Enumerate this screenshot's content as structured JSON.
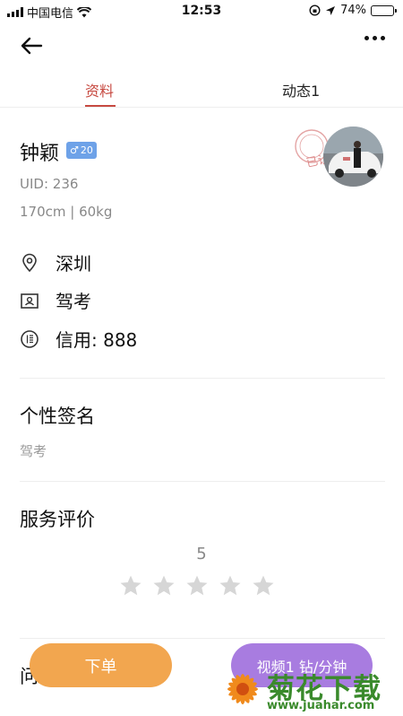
{
  "statusbar": {
    "carrier": "中国电信",
    "time": "12:53",
    "battery": "74%",
    "battery_level": 0.74
  },
  "tabs": [
    {
      "label": "资料",
      "active": true
    },
    {
      "label": "动态1",
      "active": false
    }
  ],
  "profile": {
    "name": "钟颖",
    "gender_symbol": "♂",
    "age": "20",
    "uid": "UID: 236",
    "height_weight": "170cm | 60kg",
    "stamp_text": "已认"
  },
  "info": {
    "city": "深圳",
    "service": "驾考",
    "credit": "信用: 888"
  },
  "signature": {
    "title": "个性签名",
    "text": "驾考"
  },
  "review": {
    "title": "服务评价",
    "score": "5",
    "stars_filled": 0,
    "stars_total": 5
  },
  "partial_section_title": "问",
  "actions": {
    "order": "下单",
    "video": "视频1 钻/分钟"
  },
  "watermark": {
    "name": "菊花下载网",
    "url": "www.juahar.com"
  },
  "colors": {
    "accent": "#c74a41",
    "order": "#f2a64f",
    "video": "#a87ce0",
    "badge": "#6ea2e8",
    "star": "#d6d6d6"
  }
}
